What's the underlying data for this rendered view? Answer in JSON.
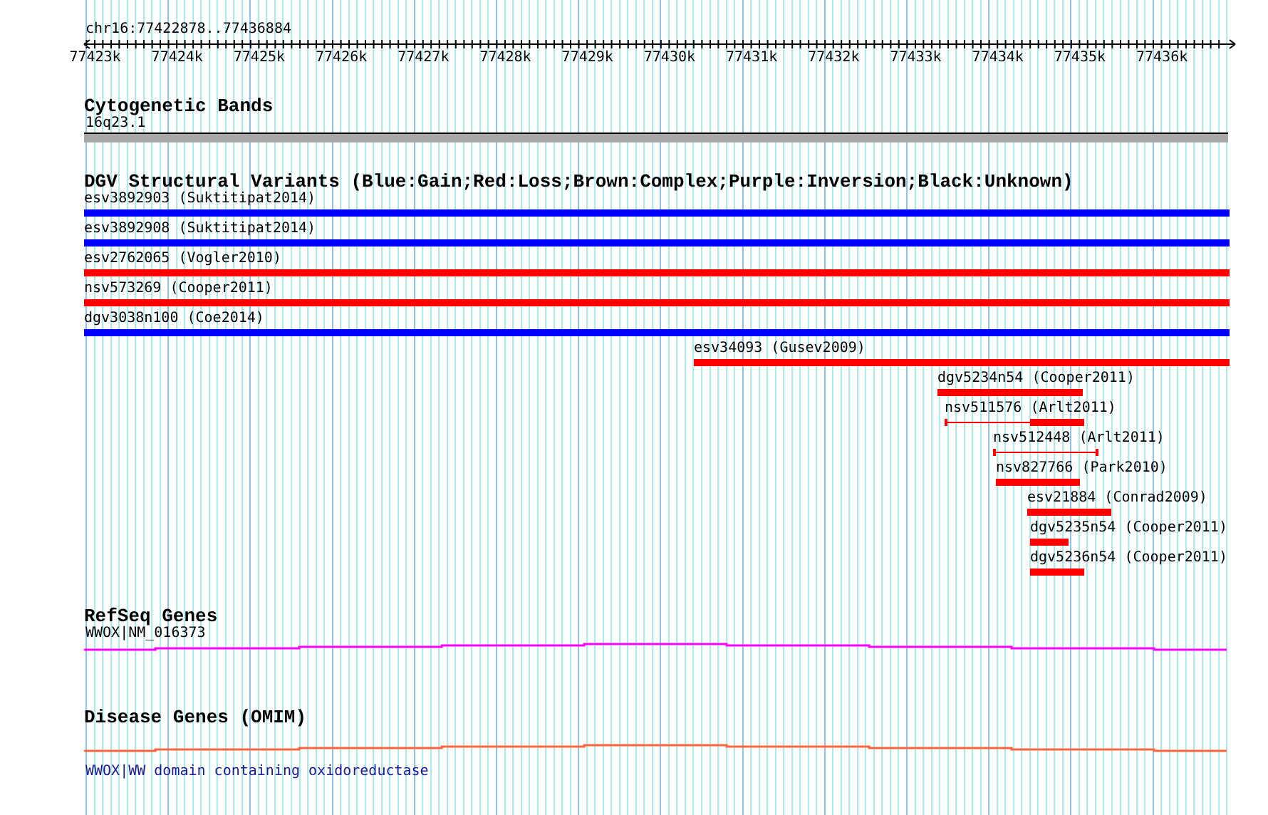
{
  "region": "chr16:77422878..77436884",
  "ruler": {
    "ticks": [
      "77423k",
      "77424k",
      "77425k",
      "77426k",
      "77427k",
      "77428k",
      "77429k",
      "77430k",
      "77431k",
      "77432k",
      "77433k",
      "77434k",
      "77435k",
      "77436k"
    ]
  },
  "tracks": [
    {
      "kind": "bands",
      "title": "Cytogenetic Bands",
      "features": [
        {
          "label": "16q23.1"
        }
      ]
    },
    {
      "kind": "variants",
      "title": "DGV Structural Variants (Blue:Gain;Red:Loss;Brown:Complex;Purple:Inversion;Black:Unknown)",
      "features": [
        {
          "label": "esv3892903 (Suktitipat2014)",
          "color": "#0000ff"
        },
        {
          "label": "esv3892908 (Suktitipat2014)",
          "color": "#0000ff"
        },
        {
          "label": "esv2762065 (Vogler2010)",
          "color": "#ff0000"
        },
        {
          "label": "nsv573269 (Cooper2011)",
          "color": "#ff0000"
        },
        {
          "label": "dgv3038n100 (Coe2014)",
          "color": "#0000ff"
        },
        {
          "label": "esv34093 (Gusev2009)",
          "color": "#ff0000"
        },
        {
          "label": "dgv5234n54 (Cooper2011)",
          "color": "#ff0000"
        },
        {
          "label": "nsv511576 (Arlt2011)",
          "color": "#ff0000"
        },
        {
          "label": "nsv512448 (Arlt2011)",
          "color": "#ff0000"
        },
        {
          "label": "nsv827766 (Park2010)",
          "color": "#ff0000"
        },
        {
          "label": "esv21884 (Conrad2009)",
          "color": "#ff0000"
        },
        {
          "label": "dgv5235n54 (Cooper2011)",
          "color": "#ff0000"
        },
        {
          "label": "dgv5236n54 (Cooper2011)",
          "color": "#ff0000"
        }
      ]
    },
    {
      "kind": "gene",
      "title": "RefSeq Genes",
      "features": [
        {
          "label": "WWOX|NM_016373"
        }
      ]
    },
    {
      "kind": "omim",
      "title": "Disease Genes (OMIM)",
      "features": [
        {
          "label": "WWOX|WW domain containing oxidoreductase"
        }
      ]
    }
  ]
}
